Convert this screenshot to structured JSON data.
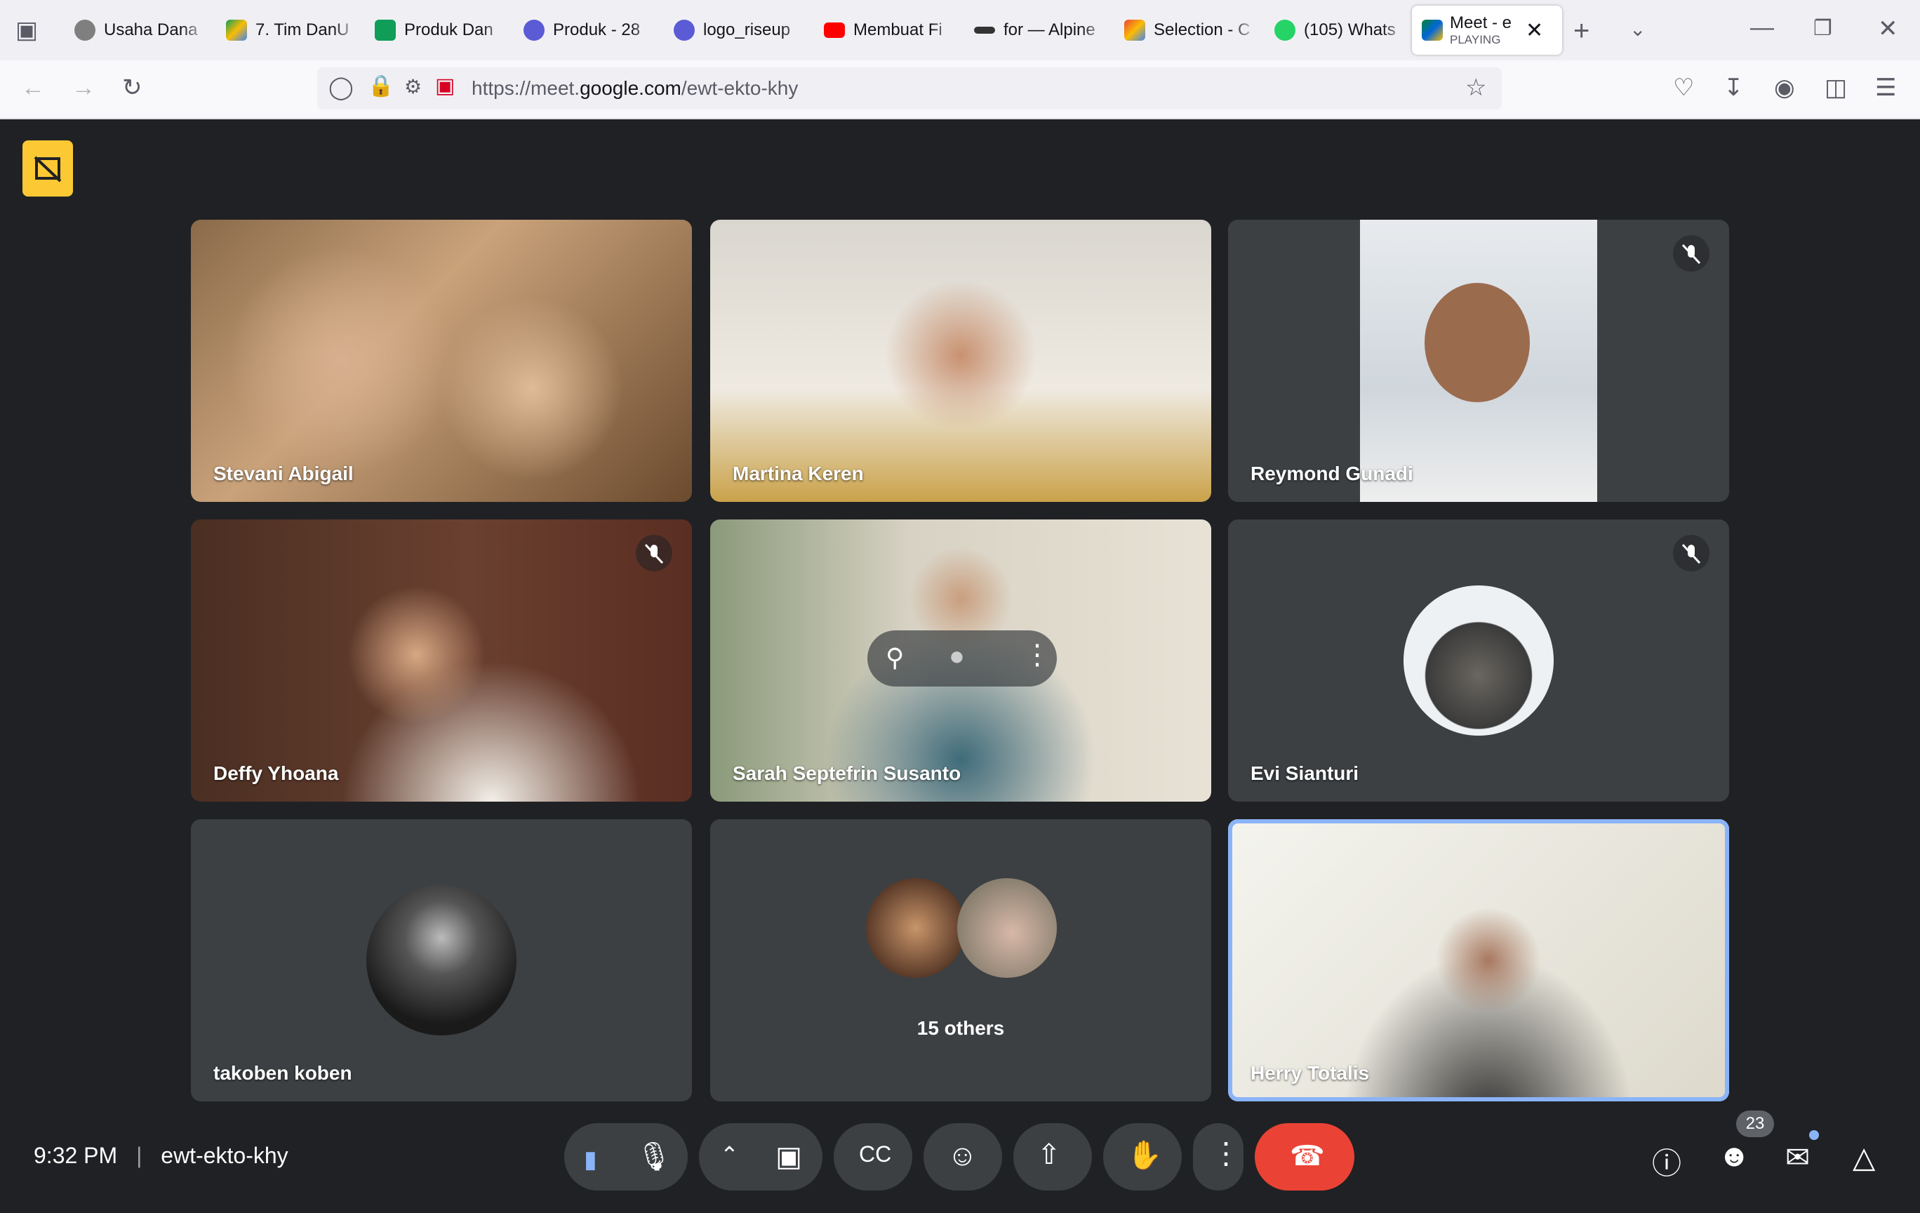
{
  "browser": {
    "tabs": [
      {
        "label": "Usaha Dana",
        "color": "#7f7f7f"
      },
      {
        "label": "7. Tim DanU",
        "color": "#1a73e8"
      },
      {
        "label": "Produk Dan",
        "color": "#0f9d58"
      },
      {
        "label": "Produk - 28",
        "color": "#5b5bd6"
      },
      {
        "label": "logo_riseup",
        "color": "#5b5bd6"
      },
      {
        "label": "Membuat Fi",
        "color": "#ff0000"
      },
      {
        "label": "for — Alpine",
        "color": "#333333"
      },
      {
        "label": "Selection - C",
        "color": "#ea4335"
      },
      {
        "label": "(105) Whats",
        "color": "#25d366"
      }
    ],
    "active_tab": {
      "label": "Meet - e",
      "sublabel": "PLAYING"
    },
    "url_prefix": "https://meet.",
    "url_domain": "google.com",
    "url_path": "/ewt-ekto-khy"
  },
  "meet": {
    "participants": [
      {
        "name": "Stevani Abigail",
        "muted": false
      },
      {
        "name": "Martina Keren",
        "muted": false
      },
      {
        "name": "Reymond Gunadi",
        "muted": true
      },
      {
        "name": "Deffy Yhoana",
        "muted": true
      },
      {
        "name": "Sarah Septefrin Susanto",
        "muted": false
      },
      {
        "name": "Evi Sianturi",
        "muted": true
      },
      {
        "name": "takoben koben",
        "muted": false
      },
      {
        "name": "Herry Totalis",
        "muted": false
      }
    ],
    "others_label": "15 others",
    "time": "9:32 PM",
    "meeting_code": "ewt-ekto-khy",
    "people_count": "23",
    "colors": {
      "accent": "#8ab4f8",
      "end_call": "#ea4335",
      "badge": "#fcc934"
    }
  }
}
